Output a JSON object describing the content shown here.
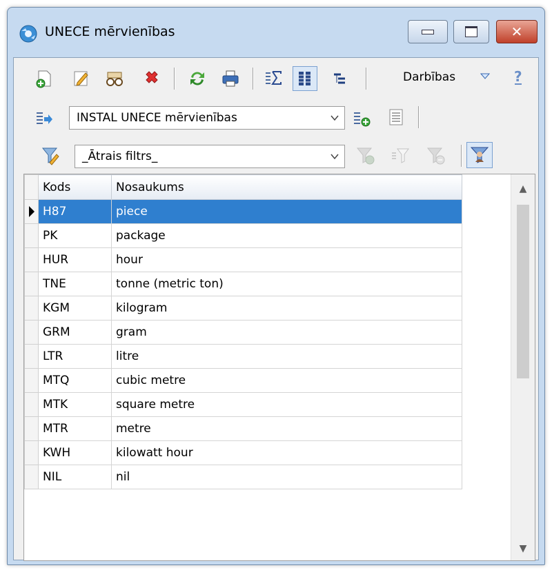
{
  "window": {
    "title": "UNECE mērvienības"
  },
  "toolbar": {
    "actions_label": "Darbības"
  },
  "data_source": {
    "selected": "INSTAL UNECE mērvienības"
  },
  "filter": {
    "selected": "_Ātrais filtrs_"
  },
  "grid": {
    "columns": [
      "Kods",
      "Nosaukums"
    ],
    "selected_row": 0,
    "rows": [
      {
        "kods": "H87",
        "nosaukums": "piece"
      },
      {
        "kods": "PK",
        "nosaukums": "package"
      },
      {
        "kods": "HUR",
        "nosaukums": "hour"
      },
      {
        "kods": "TNE",
        "nosaukums": "tonne (metric ton)"
      },
      {
        "kods": "KGM",
        "nosaukums": "kilogram"
      },
      {
        "kods": "GRM",
        "nosaukums": "gram"
      },
      {
        "kods": "LTR",
        "nosaukums": "litre"
      },
      {
        "kods": "MTQ",
        "nosaukums": "cubic metre"
      },
      {
        "kods": "MTK",
        "nosaukums": "square metre"
      },
      {
        "kods": "MTR",
        "nosaukums": "metre"
      },
      {
        "kods": "KWH",
        "nosaukums": "kilowatt hour"
      },
      {
        "kods": "NIL",
        "nosaukums": "nil"
      }
    ]
  },
  "colors": {
    "selection": "#2f7fcf",
    "window_frame": "#c6daf0"
  }
}
